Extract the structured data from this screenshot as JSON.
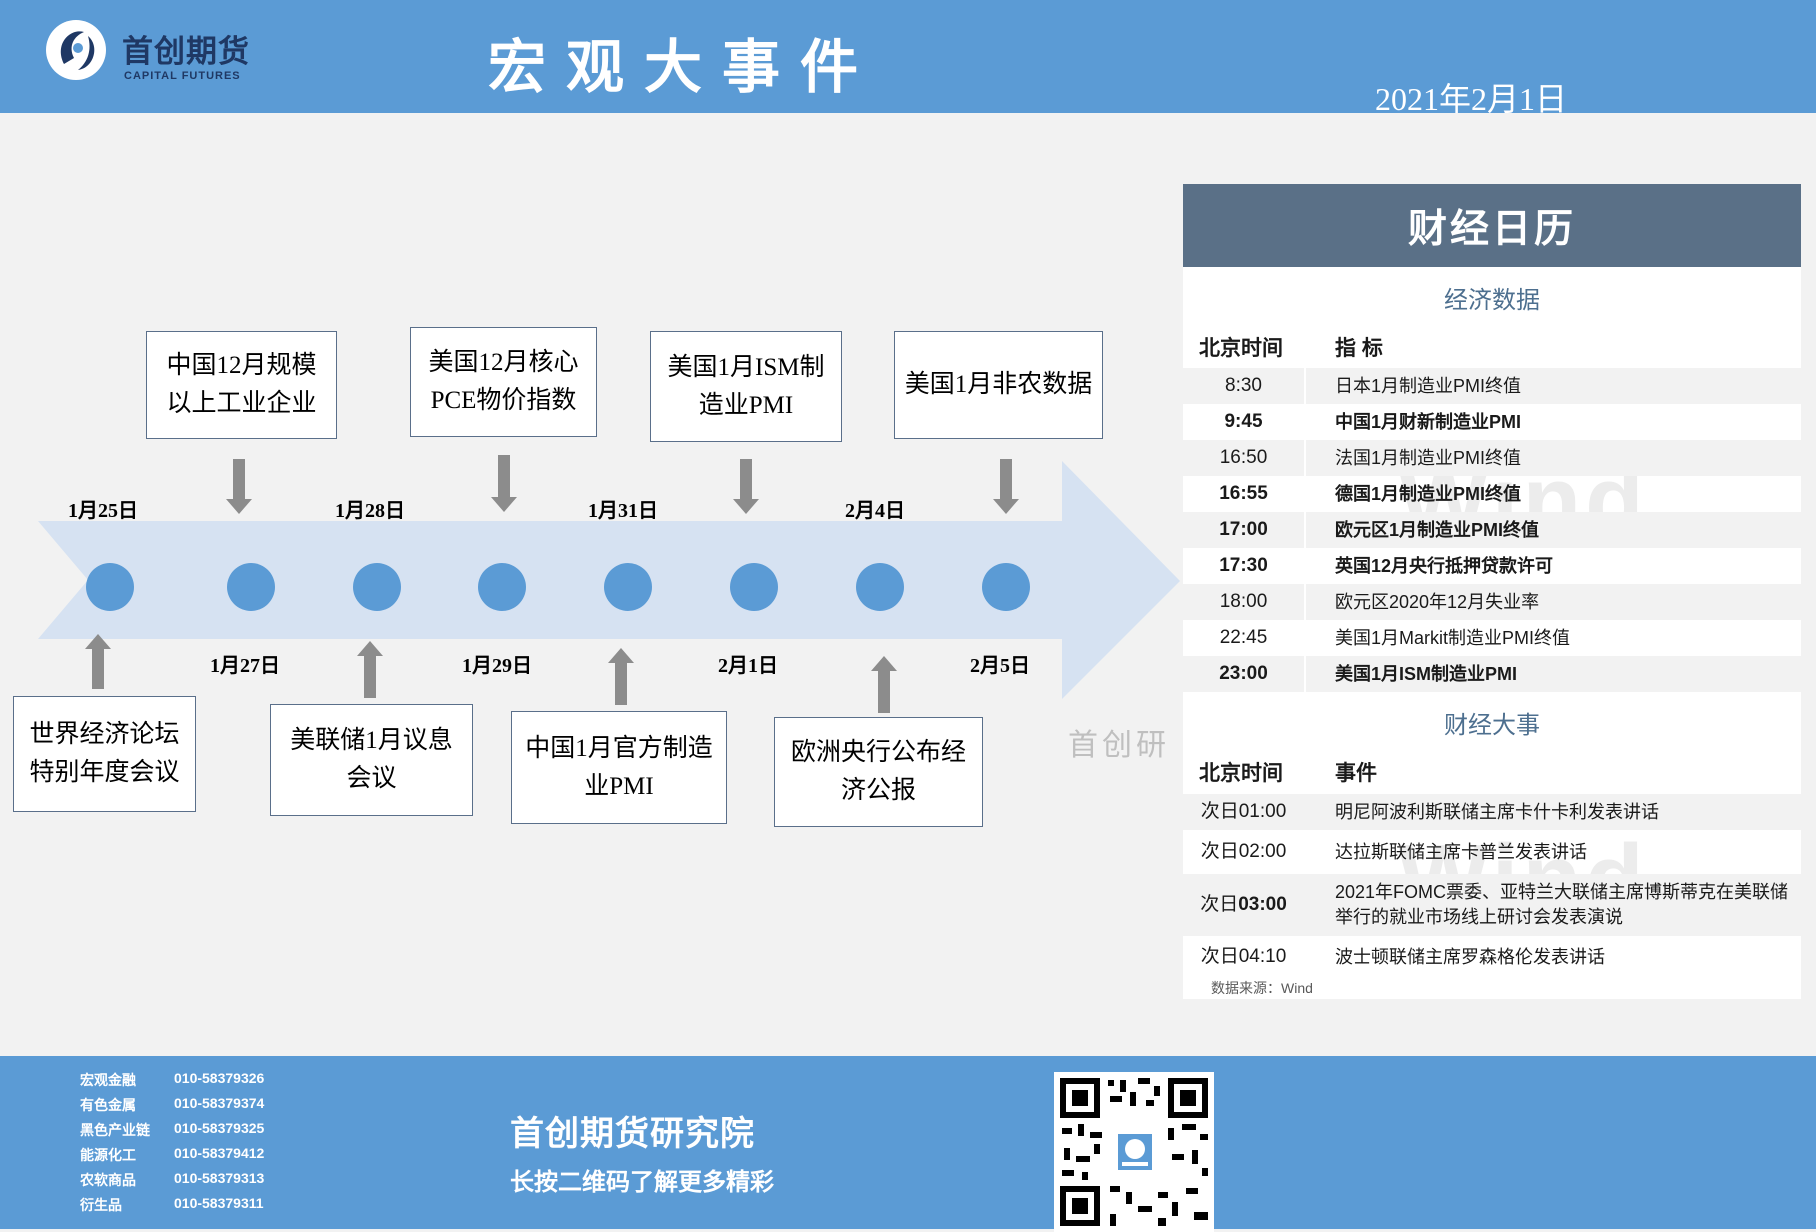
{
  "header": {
    "logo_name": "首创期货",
    "logo_sub": "CAPITAL FUTURES",
    "title": "宏观大事件",
    "date": "2021年2月1日"
  },
  "timeline": {
    "dates_top": [
      "1月25日",
      "1月28日",
      "1月31日",
      "2月4日"
    ],
    "dates_bottom": [
      "1月27日",
      "1月29日",
      "2月1日",
      "2月5日"
    ],
    "events_top": [
      "中国12月规模以上工业企业",
      "美国12月核心PCE物价指数",
      "美国1月ISM制造业PMI",
      "美国1月非农数据"
    ],
    "events_bottom": [
      "世界经济论坛特别年度会议",
      "美联储1月议息会议",
      "中国1月官方制造业PMI",
      "欧洲央行公布经济公报"
    ],
    "watermark": "首创研"
  },
  "calendar": {
    "title": "财经日历",
    "econ_title": "经济数据",
    "col_time": "北京时间",
    "col_indicator": "指  标",
    "econ_rows": [
      {
        "time": "8:30",
        "text": "日本1月制造业PMI终值"
      },
      {
        "time": "9:45",
        "text": "中国1月财新制造业PMI"
      },
      {
        "time": "16:50",
        "text": "法国1月制造业PMI终值"
      },
      {
        "time": "16:55",
        "text": "德国1月制造业PMI终值"
      },
      {
        "time": "17:00",
        "text": "欧元区1月制造业PMI终值"
      },
      {
        "time": "17:30",
        "text": "英国12月央行抵押贷款许可"
      },
      {
        "time": "18:00",
        "text": "欧元区2020年12月失业率"
      },
      {
        "time": "22:45",
        "text": "美国1月Markit制造业PMI终值"
      },
      {
        "time": "23:00",
        "text": "美国1月ISM制造业PMI"
      }
    ],
    "events_title": "财经大事",
    "col_event": "事件",
    "event_rows": [
      {
        "prefix": "次日",
        "time": "01:00",
        "text": "明尼阿波利斯联储主席卡什卡利发表讲话"
      },
      {
        "prefix": "次日",
        "time": "02:00",
        "text": "达拉斯联储主席卡普兰发表讲话"
      },
      {
        "prefix": "次日",
        "time": "03:00",
        "text": "2021年FOMC票委、亚特兰大联储主席博斯蒂克在美联储举行的就业市场线上研讨会发表演说"
      },
      {
        "prefix": "次日",
        "time": "04:10",
        "text": "波士顿联储主席罗森格伦发表讲话"
      }
    ],
    "source": "数据来源：Wind",
    "watermark": "Wind"
  },
  "footer": {
    "contacts": [
      {
        "dept": "宏观金融",
        "phone": "010-58379326"
      },
      {
        "dept": "有色金属",
        "phone": "010-58379374"
      },
      {
        "dept": "黑色产业链",
        "phone": "010-58379325"
      },
      {
        "dept": "能源化工",
        "phone": "010-58379412"
      },
      {
        "dept": "农软商品",
        "phone": "010-58379313"
      },
      {
        "dept": "衍生品",
        "phone": "010-58379311"
      }
    ],
    "institute": "首创期货研究院",
    "slogan": "长按二维码了解更多精彩"
  },
  "colors": {
    "header_bg": "#5b9bd5",
    "arrow": "#d6e2f2",
    "dot": "#5b9bd5",
    "panel_head": "#5a7087"
  }
}
